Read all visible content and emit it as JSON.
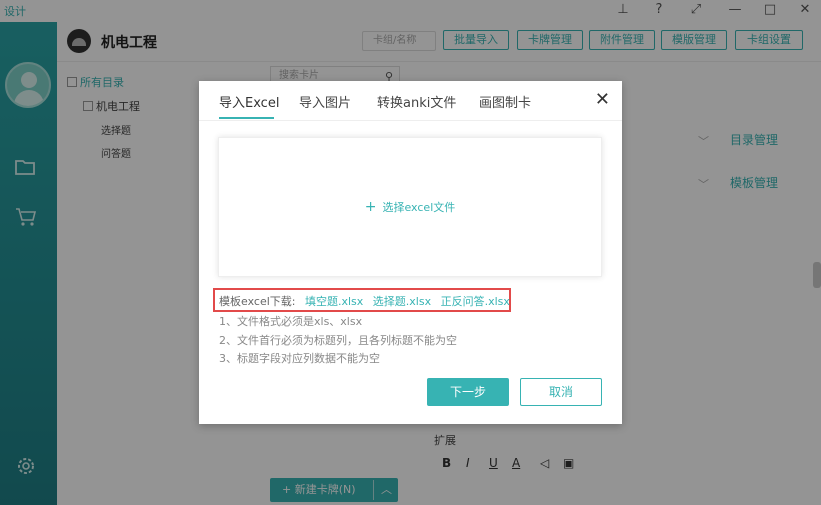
{
  "window": {
    "app_name": "设计",
    "controls": [
      "⊥",
      "?",
      "⤢",
      "—",
      "□",
      "✕"
    ]
  },
  "rail": {
    "icons": [
      "avatar",
      "folder-icon",
      "cart-icon",
      "gear-icon"
    ]
  },
  "header": {
    "project_title": "机电工程",
    "search_placeholder": "卡组/名称",
    "buttons": [
      "批量导入",
      "卡牌管理",
      "附件管理",
      "模版管理",
      "卡组设置"
    ]
  },
  "tree": {
    "root": "所有目录",
    "child": "机电工程",
    "leaves": [
      "选择题",
      "问答题"
    ],
    "search_placeholder": "搜索卡片"
  },
  "right_panel": {
    "dir_manage": "目录管理",
    "template_manage": "模板管理",
    "extension_label": "扩展",
    "format_tools": [
      "B",
      "I",
      "U",
      "A",
      "◁",
      "▣"
    ]
  },
  "new_card_button": "+ 新建卡牌(N)",
  "dialog": {
    "tabs": [
      "导入Excel",
      "导入图片",
      "转换anki文件",
      "画图制卡"
    ],
    "active_tab": 0,
    "close": "✕",
    "dropzone_label": "选择excel文件",
    "template_label": "模板excel下载:",
    "template_links": [
      "填空题.xlsx",
      "选择题.xlsx",
      "正反问答.xlsx"
    ],
    "rules": [
      "1、文件格式必须是xls、xlsx",
      "2、文件首行必须为标题列，且各列标题不能为空",
      "3、标题字段对应列数据不能为空"
    ],
    "next_button": "下一步",
    "cancel_button": "取消"
  },
  "colors": {
    "accent": "#37b3b3",
    "highlight_box": "#e24a4a"
  }
}
